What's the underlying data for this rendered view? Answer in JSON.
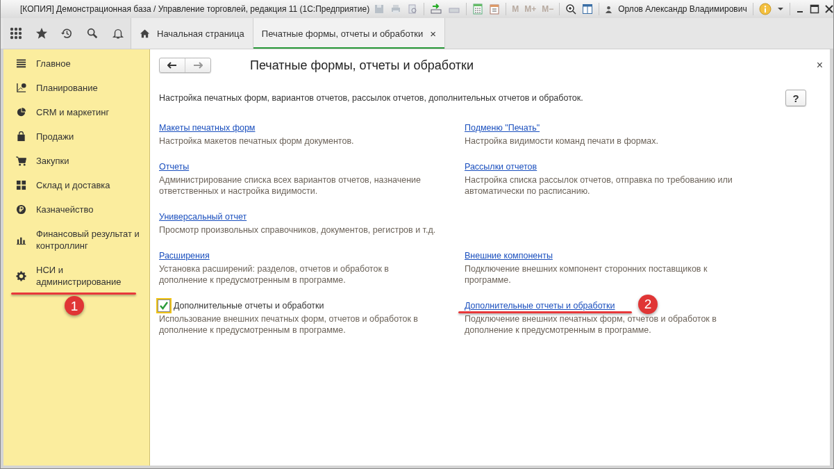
{
  "window": {
    "title": "[КОПИЯ] Демонстрационная база / Управление торговлей, редакция 11  (1С:Предприятие)",
    "user": "Орлов Александр Владимирович",
    "memory_buttons": [
      {
        "label": "M",
        "disabled": true
      },
      {
        "label": "M+",
        "disabled": true
      },
      {
        "label": "M−",
        "disabled": true
      }
    ]
  },
  "tabs": [
    {
      "label": "Начальная страница",
      "kind": "home",
      "selected": false
    },
    {
      "label": "Печатные формы, отчеты и обработки",
      "kind": "page",
      "selected": true,
      "close": "×"
    }
  ],
  "sidebar": {
    "items": [
      {
        "label": "Главное",
        "kind": "list"
      },
      {
        "label": "Планирование",
        "kind": "planning"
      },
      {
        "label": "CRM и маркетинг",
        "kind": "pie"
      },
      {
        "label": "Продажи",
        "kind": "bag"
      },
      {
        "label": "Закупки",
        "kind": "cart"
      },
      {
        "label": "Склад и доставка",
        "kind": "grid"
      },
      {
        "label": "Казначейство",
        "kind": "ruble"
      },
      {
        "label": "Финансовый результат и контроллинг",
        "kind": "bars"
      },
      {
        "label": "НСИ и администрирование",
        "kind": "gear",
        "callout": "1"
      }
    ]
  },
  "page": {
    "title": "Печатные формы, отчеты и обработки",
    "close": "×",
    "help": "?",
    "description": "Настройка печатных форм, вариантов отчетов, рассылок отчетов, дополнительных отчетов и обработок.",
    "rows": [
      {
        "left": {
          "kind": "link",
          "label": "Макеты печатных форм",
          "text": "Настройка макетов печатных форм документов."
        },
        "right": {
          "kind": "link",
          "label": "Подменю \"Печать\"",
          "text": "Настройка видимости команд печати в формах."
        }
      },
      {
        "left": {
          "kind": "link",
          "label": "Отчеты",
          "text": "Администрирование списка всех вариантов отчетов, назначение ответственных и настройка видимости."
        },
        "right": {
          "kind": "link",
          "label": "Рассылки отчетов",
          "text": "Настройка списка рассылок отчетов, отправка по требованию или автоматически по расписанию."
        }
      },
      {
        "left": {
          "kind": "link",
          "label": "Универсальный отчет",
          "text": "Просмотр произвольных справочников, документов, регистров и т.д."
        }
      },
      {
        "left": {
          "kind": "link",
          "label": "Расширения",
          "text": "Установка расширений: разделов, отчетов и обработок в дополнение к предусмотренным в программе."
        },
        "right": {
          "kind": "link",
          "label": "Внешние компоненты",
          "text": "Подключение внешних компонент сторонних поставщиков к программе."
        }
      },
      {
        "left": {
          "kind": "checkbox",
          "label": "Дополнительные отчеты и обработки",
          "checked": true,
          "text": "Использование внешних печатных форм, отчетов и обработок в дополнение к предусмотренным в программе."
        },
        "right": {
          "kind": "link",
          "label": "Дополнительные отчеты и обработки",
          "callout": "2",
          "text": "Подключение внешних печатных форм, отчетов и обработок в дополнение к предусмотренным в программе."
        }
      }
    ]
  }
}
